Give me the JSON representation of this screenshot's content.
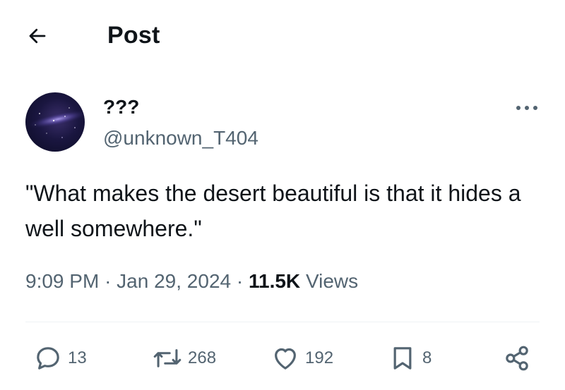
{
  "header": {
    "title": "Post",
    "back_icon": "arrow-left-icon"
  },
  "author": {
    "display_name": "???",
    "handle": "@unknown_T404",
    "avatar_colors": [
      "#0a0a22",
      "#3b2f6b",
      "#c8b8ff"
    ]
  },
  "post": {
    "text": "\"What makes the desert beautiful is that it hides a well somewhere.\"",
    "time": "9:09 PM",
    "separator": "·",
    "date": "Jan 29, 2024",
    "views_count": "11.5K",
    "views_label": "Views"
  },
  "actions": {
    "replies": "13",
    "reposts": "268",
    "likes": "192",
    "bookmarks": "8"
  },
  "icons": {
    "reply": "speech-bubble-icon",
    "repost": "repost-arrows-icon",
    "like": "heart-icon",
    "bookmark": "bookmark-icon",
    "share": "share-nodes-icon",
    "more": "ellipsis-icon"
  },
  "colors": {
    "primary_text": "#0f1419",
    "secondary_text": "#536471",
    "divider": "#eff3f4"
  }
}
